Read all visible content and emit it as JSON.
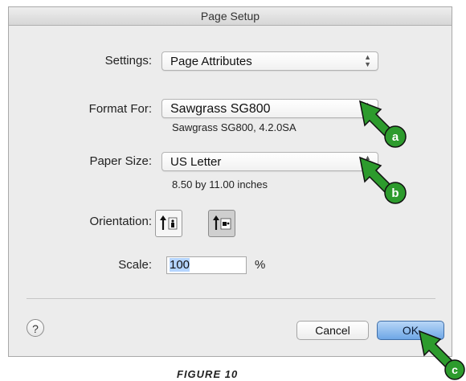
{
  "dialog": {
    "title": "Page Setup",
    "settings": {
      "label": "Settings:",
      "value": "Page Attributes"
    },
    "format_for": {
      "label": "Format For:",
      "value": "Sawgrass SG800",
      "detail": "Sawgrass SG800, 4.2.0SA"
    },
    "paper_size": {
      "label": "Paper Size:",
      "value": "US Letter",
      "detail": "8.50 by 11.00 inches"
    },
    "orientation": {
      "label": "Orientation:",
      "options": [
        "portrait-icon",
        "landscape-icon"
      ],
      "selected": "landscape"
    },
    "scale": {
      "label": "Scale:",
      "value": "100",
      "unit": "%"
    },
    "buttons": {
      "help": "?",
      "cancel": "Cancel",
      "ok": "OK"
    }
  },
  "callouts": [
    "a",
    "b",
    "c"
  ],
  "caption": "FIGURE 10",
  "colors": {
    "callout_green": "#2d9b2d",
    "ok_blue": "#6ea7e6"
  }
}
